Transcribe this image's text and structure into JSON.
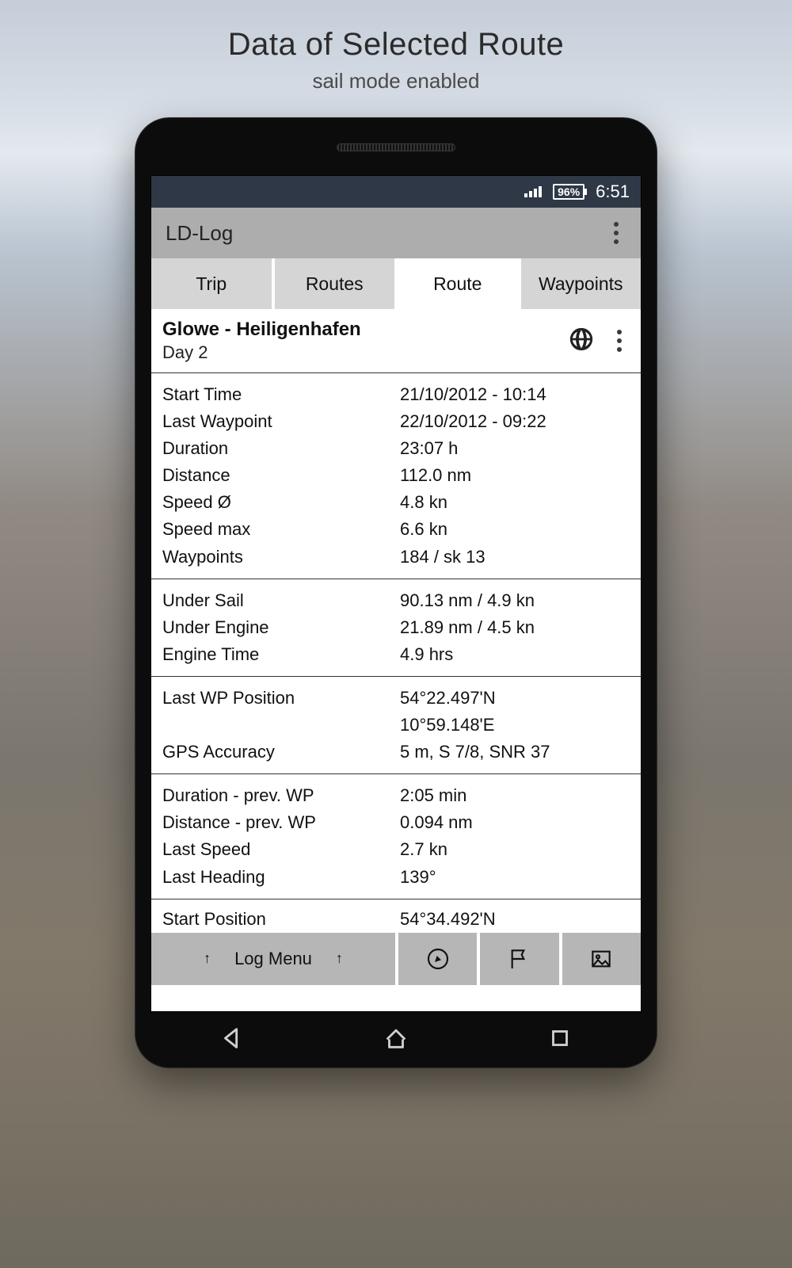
{
  "page": {
    "title": "Data of Selected Route",
    "subtitle": "sail mode enabled"
  },
  "status": {
    "battery": "96%",
    "time": "6:51"
  },
  "appbar": {
    "title": "LD-Log"
  },
  "tabs": [
    "Trip",
    "Routes",
    "Route",
    "Waypoints"
  ],
  "active_tab_index": 2,
  "route": {
    "title": "Glowe - Heiligenhafen",
    "subtitle": "Day 2"
  },
  "sections": [
    [
      {
        "k": "Start Time",
        "v": "21/10/2012 - 10:14"
      },
      {
        "k": "Last Waypoint",
        "v": "22/10/2012 - 09:22"
      },
      {
        "k": "Duration",
        "v": "23:07 h"
      },
      {
        "k": "Distance",
        "v": "112.0 nm"
      },
      {
        "k": "Speed Ø",
        "v": "4.8 kn"
      },
      {
        "k": "Speed max",
        "v": "6.6 kn"
      },
      {
        "k": "Waypoints",
        "v": "184 / sk 13"
      }
    ],
    [
      {
        "k": "Under Sail",
        "v": "90.13 nm / 4.9 kn"
      },
      {
        "k": "Under Engine",
        "v": "21.89 nm / 4.5 kn"
      },
      {
        "k": "Engine Time",
        "v": "4.9 hrs"
      }
    ],
    [
      {
        "k": "Last WP Position",
        "v": "54°22.497'N"
      },
      {
        "k": "",
        "v": "10°59.148'E"
      },
      {
        "k": "GPS Accuracy",
        "v": "5 m, S 7/8, SNR 37"
      }
    ],
    [
      {
        "k": "Duration - prev. WP",
        "v": "2:05 min"
      },
      {
        "k": "Distance - prev. WP",
        "v": "0.094 nm"
      },
      {
        "k": "Last Speed",
        "v": "2.7 kn"
      },
      {
        "k": "Last Heading",
        "v": "139°"
      }
    ]
  ],
  "overflow_row": {
    "k": "Start Position",
    "v": "54°34.492'N"
  },
  "toolbar": {
    "log_menu": "Log Menu"
  }
}
